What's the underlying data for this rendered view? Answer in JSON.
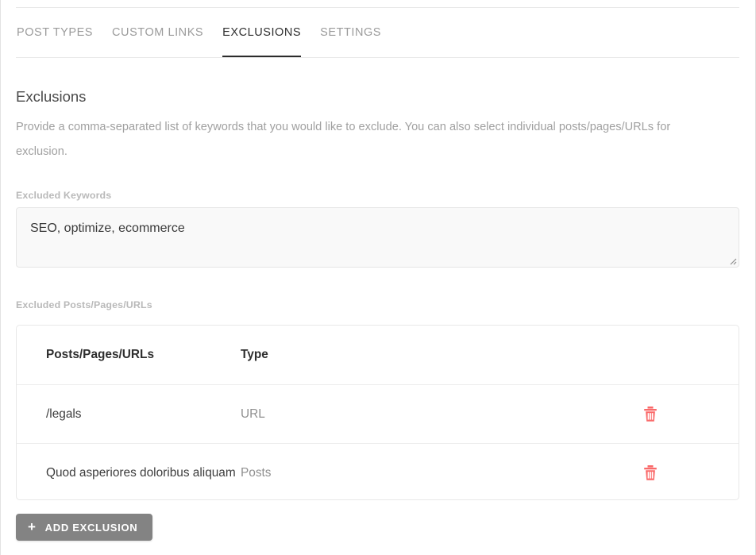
{
  "tabs": [
    {
      "label": "POST TYPES",
      "active": false
    },
    {
      "label": "CUSTOM LINKS",
      "active": false
    },
    {
      "label": "EXCLUSIONS",
      "active": true
    },
    {
      "label": "SETTINGS",
      "active": false
    }
  ],
  "section": {
    "title": "Exclusions",
    "description": "Provide a comma-separated list of keywords that you would like to exclude. You can also select individual posts/pages/URLs for exclusion."
  },
  "keywords_field": {
    "label": "Excluded Keywords",
    "value": "SEO, optimize, ecommerce",
    "placeholder": "",
    "resize_handle_icon": "resize-grip-icon"
  },
  "table": {
    "label": "Excluded Posts/Pages/URLs",
    "columns": [
      "Posts/Pages/URLs",
      "Type",
      ""
    ],
    "rows": [
      {
        "name": "/legals",
        "type": "URL",
        "delete_icon": "trash-icon"
      },
      {
        "name": "Quod asperiores doloribus aliquam",
        "type": "Posts",
        "delete_icon": "trash-icon"
      }
    ]
  },
  "add_button": {
    "label": "ADD EXCLUSION",
    "icon": "plus-icon",
    "glyph": "+"
  },
  "colors": {
    "active_tab_text": "#2b2b2b",
    "inactive_tab_text": "#9b9b9b",
    "label_gray": "#b9b9b9",
    "description_gray": "#a0a0a0",
    "button_gray": "#838383",
    "trash_red": "#fa6a6a"
  }
}
